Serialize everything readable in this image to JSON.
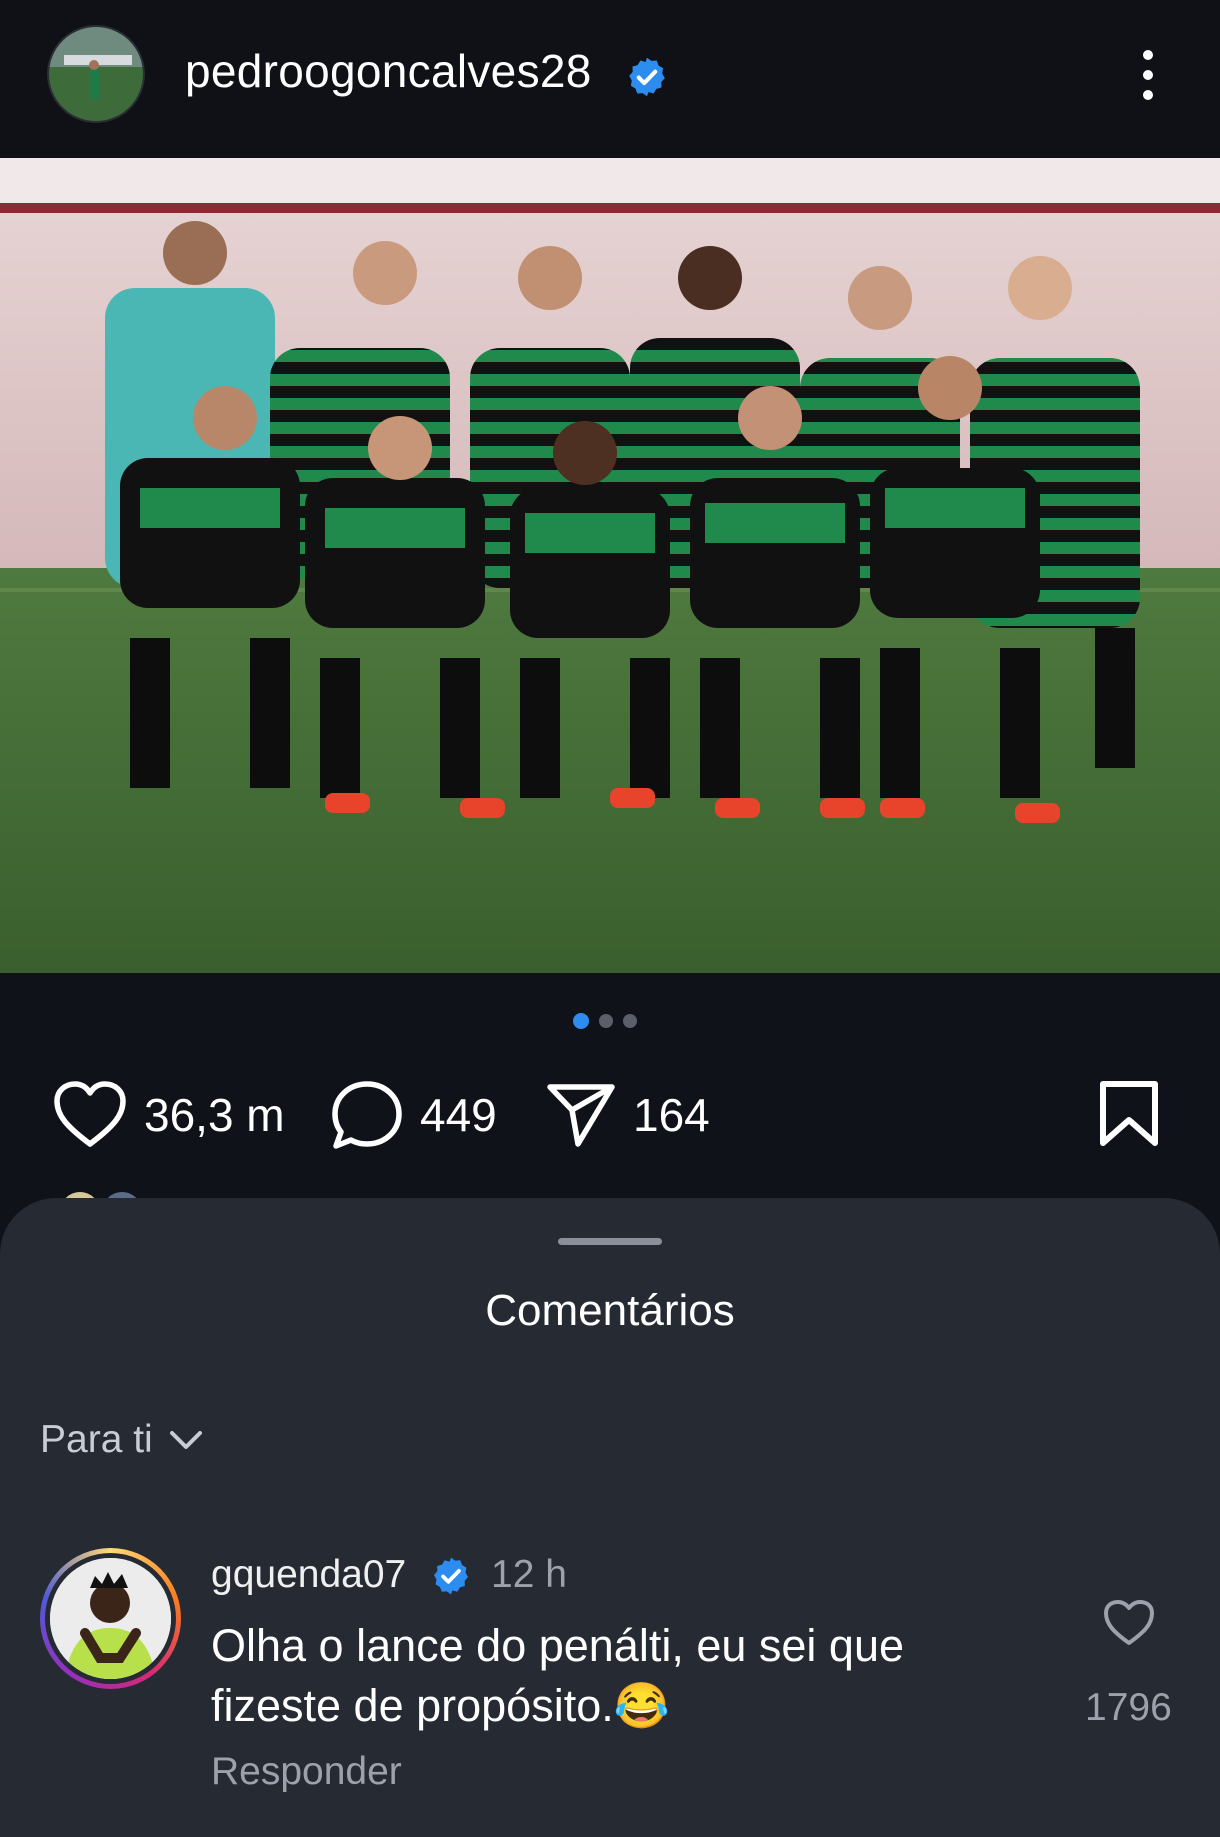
{
  "post": {
    "username": "pedroogoncalves28",
    "verified": true,
    "colors": {
      "pitch": "#3f6b33",
      "jersey_green": "#1f8a4c",
      "crowd": "#c9a9a9"
    }
  },
  "carousel": {
    "count": 3,
    "active_index": 0
  },
  "actions": {
    "likes": "36,3 m",
    "comments": "449",
    "shares": "164"
  },
  "comments_sheet": {
    "title": "Comentários",
    "filter_label": "Para ti",
    "comments": [
      {
        "username": "gquenda07",
        "verified": true,
        "time": "12 h",
        "text": "Olha o lance do penálti, eu sei que fizeste de propósito.😂",
        "reply_label": "Responder",
        "like_count": "1796"
      }
    ]
  },
  "icons": [
    "verified-icon",
    "more-icon",
    "heart-icon",
    "comment-icon",
    "share-icon",
    "bookmark-icon",
    "chevron-down-icon"
  ],
  "accent": "#2d8cf0"
}
